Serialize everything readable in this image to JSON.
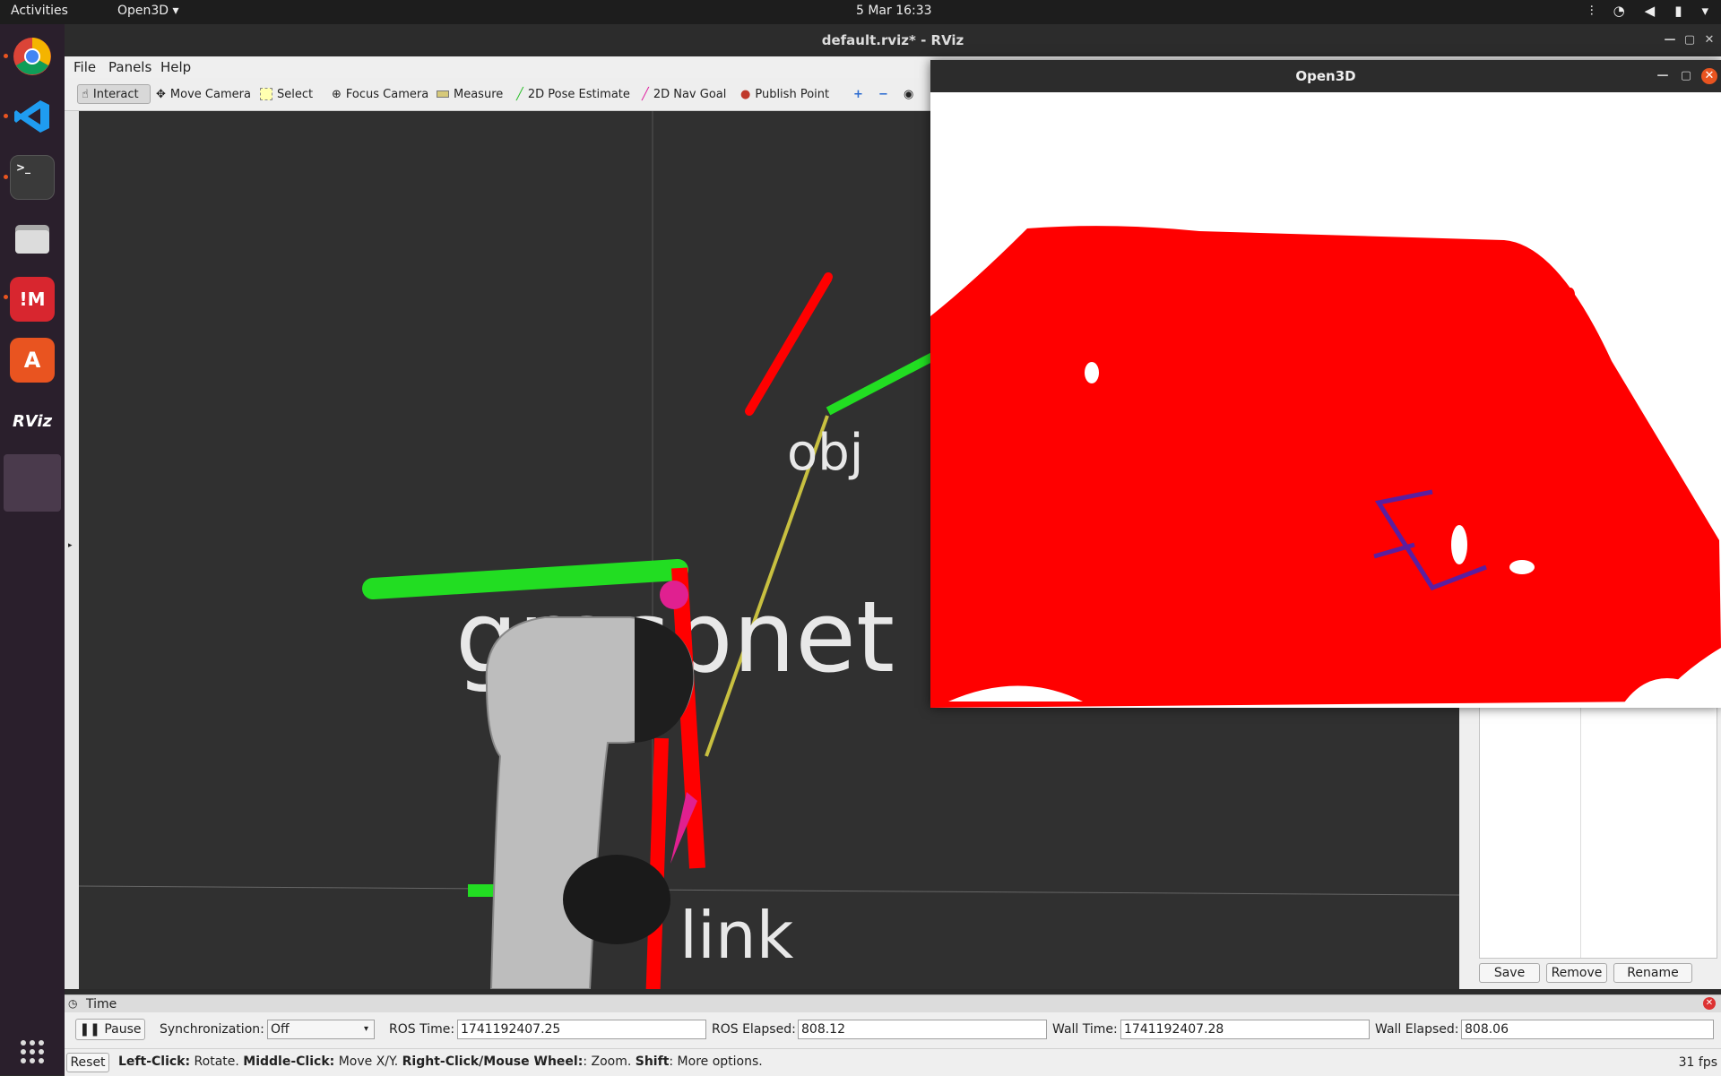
{
  "topbar": {
    "activities": "Activities",
    "app_menu": "Open3D",
    "clock": "5 Mar  16:33",
    "tray_icons": [
      "network-icon",
      "wifi-icon",
      "volume-icon",
      "battery-icon",
      "power-menu-icon"
    ]
  },
  "dock": {
    "apps": [
      {
        "name": "chrome",
        "label": ""
      },
      {
        "name": "vscode",
        "label": ""
      },
      {
        "name": "terminal",
        "label": ">_"
      },
      {
        "name": "files",
        "label": ""
      },
      {
        "name": "mendeley",
        "label": "!M"
      },
      {
        "name": "software",
        "label": "A"
      },
      {
        "name": "rviz",
        "label": "RViz"
      },
      {
        "name": "open3d",
        "label": ""
      }
    ]
  },
  "rviz": {
    "title": "default.rviz* - RViz",
    "menu": {
      "file": "File",
      "panels": "Panels",
      "help": "Help"
    },
    "toolbar": {
      "interact": "Interact",
      "move_camera": "Move Camera",
      "select": "Select",
      "focus_camera": "Focus Camera",
      "measure": "Measure",
      "pose_estimate": "2D Pose Estimate",
      "nav_goal": "2D Nav Goal",
      "publish_point": "Publish Point"
    },
    "scene_labels": {
      "obj": "obj",
      "frame": "graspnet",
      "link": "link"
    },
    "panel_buttons": {
      "save": "Save",
      "remove": "Remove",
      "rename": "Rename"
    },
    "time_panel": {
      "title": "Time",
      "pause": "Pause",
      "sync_label": "Synchronization:",
      "sync_value": "Off",
      "ros_time_label": "ROS Time:",
      "ros_time": "1741192407.25",
      "ros_elapsed_label": "ROS Elapsed:",
      "ros_elapsed": "808.12",
      "wall_time_label": "Wall Time:",
      "wall_time": "1741192407.28",
      "wall_elapsed_label": "Wall Elapsed:",
      "wall_elapsed": "808.06"
    },
    "status": {
      "reset": "Reset",
      "left_click": "Left-Click:",
      "left_click_desc": " Rotate. ",
      "middle_click": "Middle-Click:",
      "middle_click_desc": " Move X/Y. ",
      "right_click": "Right-Click/Mouse Wheel:",
      "right_click_desc": ": Zoom. ",
      "shift": "Shift",
      "shift_desc": ": More options.",
      "fps": "31 fps"
    }
  },
  "open3d": {
    "title": "Open3D"
  },
  "colors": {
    "topbar": "#1d1d1d",
    "dock": "#2a1f2c",
    "accent": "#e95420",
    "pointcloud": "#ff0000",
    "axis_x": "#ff0000",
    "axis_y": "#00ff00",
    "grasp": "#5a1fa0"
  }
}
